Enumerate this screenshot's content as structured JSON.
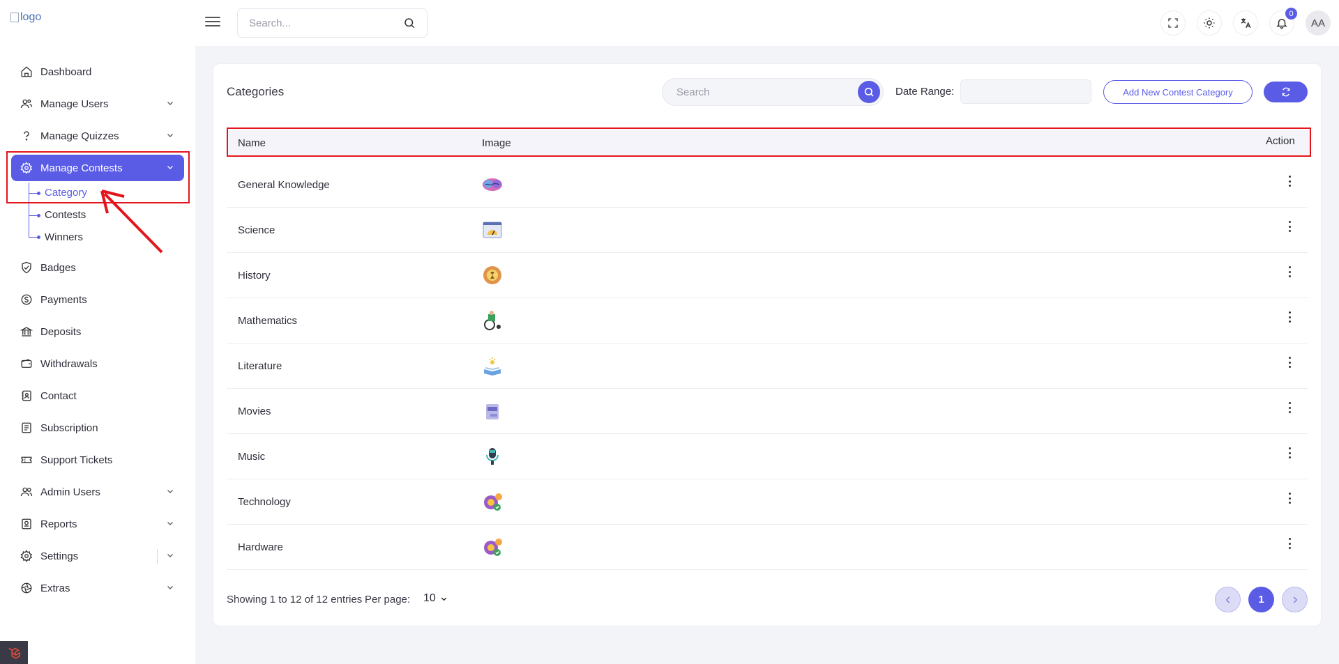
{
  "header": {
    "logo_alt": "logo",
    "search_placeholder": "Search...",
    "notification_count": "0",
    "avatar_initials": "AA"
  },
  "sidebar": {
    "items": [
      {
        "label": "Dashboard",
        "icon": "home-icon"
      },
      {
        "label": "Manage Users",
        "icon": "users-icon"
      },
      {
        "label": "Manage Quizzes",
        "icon": "question-icon"
      },
      {
        "label": "Manage Contests",
        "icon": "contest-gear-icon"
      },
      {
        "label": "Badges",
        "icon": "shield-check-icon"
      },
      {
        "label": "Payments",
        "icon": "dollar-icon"
      },
      {
        "label": "Deposits",
        "icon": "bank-icon"
      },
      {
        "label": "Withdrawals",
        "icon": "wallet-icon"
      },
      {
        "label": "Contact",
        "icon": "contact-book-icon"
      },
      {
        "label": "Subscription",
        "icon": "subscription-icon"
      },
      {
        "label": "Support Tickets",
        "icon": "ticket-icon"
      },
      {
        "label": "Admin Users",
        "icon": "admin-users-icon"
      },
      {
        "label": "Reports",
        "icon": "report-icon"
      },
      {
        "label": "Settings",
        "icon": "gear-icon"
      },
      {
        "label": "Extras",
        "icon": "aperture-icon"
      }
    ],
    "contest_sub": [
      "Category",
      "Contests",
      "Winners"
    ]
  },
  "main": {
    "title": "Categories",
    "search_placeholder": "Search",
    "date_range_label": "Date Range:",
    "add_button": "Add New Contest Category",
    "columns": {
      "name": "Name",
      "image": "Image",
      "action": "Action"
    },
    "rows": [
      {
        "name": "General Knowledge",
        "image": "brain-icon"
      },
      {
        "name": "Science",
        "image": "gauge-window-icon"
      },
      {
        "name": "History",
        "image": "hourglass-circle-icon"
      },
      {
        "name": "Mathematics",
        "image": "wheelchair-icon"
      },
      {
        "name": "Literature",
        "image": "open-book-icon"
      },
      {
        "name": "Movies",
        "image": "film-file-icon"
      },
      {
        "name": "Music",
        "image": "microphone-icon"
      },
      {
        "name": "Technology",
        "image": "gear-check-icon"
      },
      {
        "name": "Hardware",
        "image": "gear-check-icon"
      }
    ],
    "footer": {
      "showing": "Showing 1 to 12 of 12 entries",
      "per_page_label": "Per page:",
      "per_page_value": "10",
      "current_page": "1"
    }
  },
  "colors": {
    "accent": "#5b5ce6",
    "annotation": "#e3141c"
  }
}
